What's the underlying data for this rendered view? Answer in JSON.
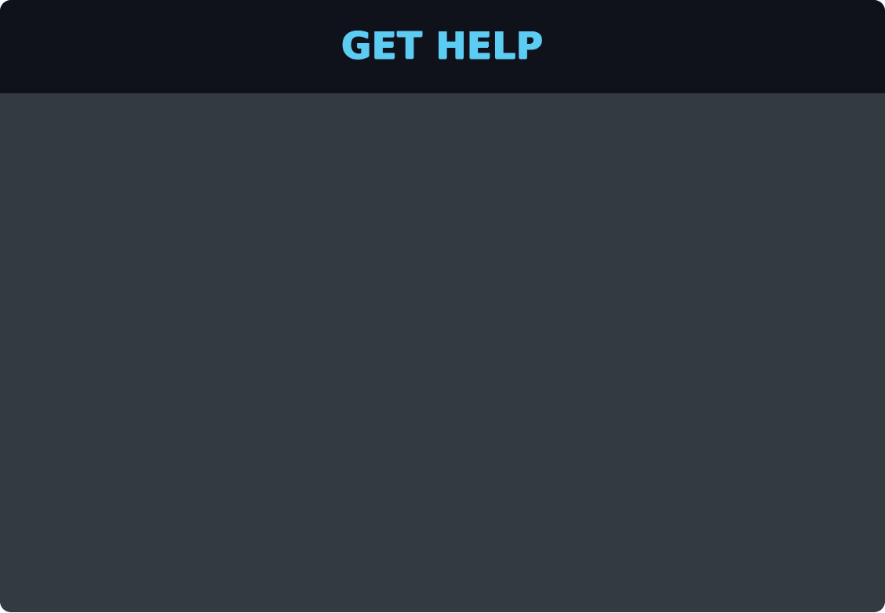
{
  "dialog": {
    "title": "GET HELP"
  },
  "colors": {
    "header_bg": "#0f121b",
    "body_bg": "#343a42",
    "title_color": "#5dccf3"
  }
}
